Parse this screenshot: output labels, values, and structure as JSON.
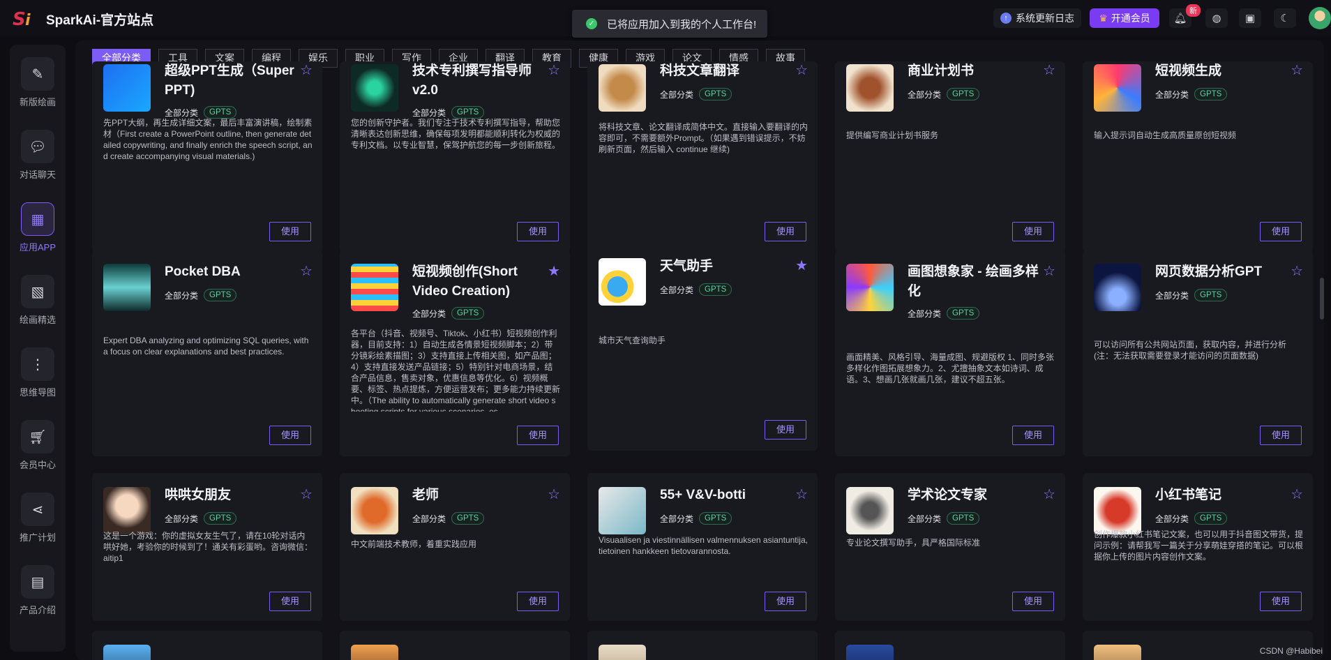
{
  "header": {
    "site_title": "SparkAi-官方站点",
    "logo_text": "Si",
    "toast": "已将应用加入到我的个人工作台!",
    "changelog": "系统更新日志",
    "vip": "开通会员",
    "badge_new": "新"
  },
  "sidebar": {
    "items": [
      {
        "label": "新版绘画",
        "icon": "pen-icon"
      },
      {
        "label": "对话聊天",
        "icon": "chat-icon"
      },
      {
        "label": "应用APP",
        "icon": "grid-icon"
      },
      {
        "label": "绘画精选",
        "icon": "image-icon"
      },
      {
        "label": "思维导图",
        "icon": "mindmap-icon"
      },
      {
        "label": "会员中心",
        "icon": "cart-icon"
      },
      {
        "label": "推广计划",
        "icon": "share-icon"
      },
      {
        "label": "产品介绍",
        "icon": "box-icon"
      }
    ]
  },
  "categories": [
    "全部分类",
    "工具",
    "文案",
    "编程",
    "娱乐",
    "职业",
    "写作",
    "企业",
    "翻译",
    "教育",
    "健康",
    "游戏",
    "论文",
    "情感",
    "故事"
  ],
  "card_common": {
    "category": "全部分类",
    "tag": "GPTS",
    "use": "使用"
  },
  "cards": [
    {
      "title": "超级PPT生成（Super PPT)",
      "desc": "先PPT大纲，再生成详细文案，最后丰富演讲稿，绘制素材（First create a PowerPoint outline, then generate detailed copywriting, and finally enrich the speech script, and create accompanying visual materials.)"
    },
    {
      "title": "技术专利撰写指导师v2.0",
      "desc": "您的创新守护者。我们专注于技术专利撰写指导，帮助您清晰表达创新思维，确保每项发明都能顺利转化为权威的专利文档。以专业智慧，保驾护航您的每一步创新旅程。"
    },
    {
      "title": "科技文章翻译",
      "desc": "将科技文章、论文翻译成简体中文。直接输入要翻译的内容即可，不需要额外Prompt。（如果遇到错误提示，不妨刷新页面，然后输入 continue 继续)"
    },
    {
      "title": "商业计划书",
      "desc": "提供编写商业计划书服务"
    },
    {
      "title": "短视频生成",
      "desc": "输入提示词自动生成高质量原创短视频"
    },
    {
      "title": "Pocket DBA",
      "desc": "Expert DBA analyzing and optimizing SQL queries, with a focus on clear explanations and best practices."
    },
    {
      "title": "短视频创作(Short Video Creation)",
      "desc": "各平台（抖音、视频号、Tiktok、小红书）短视频创作利器，目前支持：1）自动生成各情景短视频脚本；2）带分镜彩绘素描图；3）支持直接上传相关图，如产品图；4）支持直接发送产品链接；5）特别针对电商场景，结合产品信息，售卖对象，优惠信息等优化。6）视频概要、标签、热点提炼，方便运营发布；更多能力持续更新中。（The ability to automatically generate short video shooting scripts for various scenarios, es"
    },
    {
      "title": "天气助手",
      "desc": "城市天气查询助手"
    },
    {
      "title": "画图想象家 - 绘画多样化",
      "desc": "画面精美、风格引导、海量成图、规避版权 1、同时多张多样化作图拓展想象力。2、尤擅抽象文本如诗词、成语。3、想画几张就画几张，建议不超五张。"
    },
    {
      "title": "网页数据分析GPT",
      "desc": "可以访问所有公共网站页面，获取内容，并进行分析(注：无法获取需要登录才能访问的页面数据)"
    },
    {
      "title": "哄哄女朋友",
      "desc": "这是一个游戏：你的虚拟女友生气了，请在10轮对话内哄好她，考验你的时候到了！通关有彩蛋哟。咨询微信：aitip1"
    },
    {
      "title": "老师",
      "desc": "中文前端技术教师，着重实践应用"
    },
    {
      "title": "55+ V&V-botti",
      "desc": "Visuaalisen ja viestinnällisen valmennuksen asiantuntija, tietoinen hankkeen tietovarannosta."
    },
    {
      "title": "学术论文专家",
      "desc": "专业论文撰写助手，具严格国际标准"
    },
    {
      "title": "小红书笔记",
      "desc": "创作爆款小红书笔记文案，也可以用于抖音图文带货，提问示例：请帮我写一篇关于分享萌娃穿搭的笔记。可以根据你上传的图片内容创作文案。"
    }
  ],
  "watermark": "CSDN @Habibei"
}
